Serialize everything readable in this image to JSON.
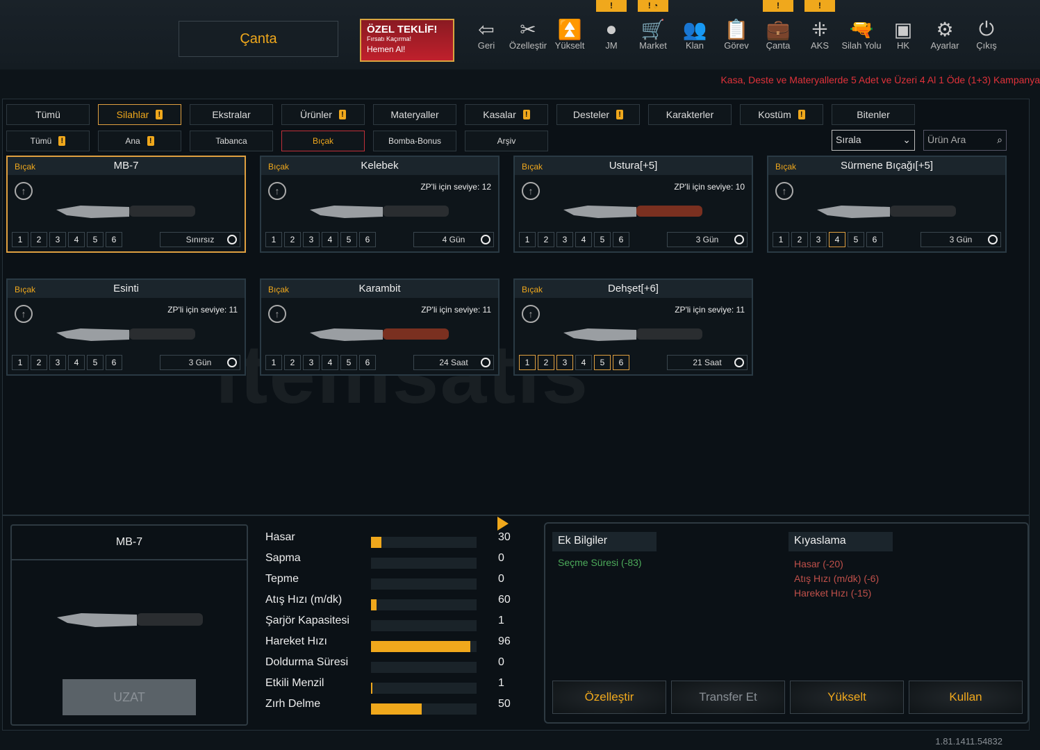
{
  "header": {
    "canta_button": "Çanta",
    "offer": {
      "title": "ÖZEL TEKLİF!",
      "subtitle": "Fırsatı Kaçırma!",
      "cta": "Hemen Al!"
    },
    "nav": [
      {
        "label": "Geri",
        "icon": "exit-icon",
        "glyph": "⇦"
      },
      {
        "label": "Özelleştir",
        "icon": "tools-icon",
        "glyph": "✂"
      },
      {
        "label": "Yükselt",
        "icon": "rank-up-icon",
        "glyph": "⏫"
      },
      {
        "label": "JM",
        "icon": "coins-icon",
        "glyph": "●"
      },
      {
        "label": "Market",
        "icon": "cart-icon",
        "glyph": "🛒"
      },
      {
        "label": "Klan",
        "icon": "clan-icon",
        "glyph": "👥"
      },
      {
        "label": "Görev",
        "icon": "clipboard-icon",
        "glyph": "📋"
      },
      {
        "label": "Çanta",
        "icon": "bag-icon",
        "glyph": "💼"
      },
      {
        "label": "AKS",
        "icon": "dots-icon",
        "glyph": "⁜"
      },
      {
        "label": "Silah Yolu",
        "icon": "pistol-icon",
        "glyph": "🔫"
      },
      {
        "label": "HK",
        "icon": "wallet-icon",
        "glyph": "▣"
      },
      {
        "label": "Ayarlar",
        "icon": "gear-icon",
        "glyph": "⚙"
      },
      {
        "label": "Çıkış",
        "icon": "power-icon",
        "glyph": "⏻"
      }
    ],
    "badges": [
      "!",
      "! ◔",
      "!",
      "!"
    ],
    "promo": "Kasa, Deste ve Materyallerde 5 Adet ve Üzeri 4 Al 1 Öde (1+3) Kampanya"
  },
  "tabs": [
    {
      "label": "Tümü"
    },
    {
      "label": "Silahlar",
      "alert": true
    },
    {
      "label": "Ekstralar"
    },
    {
      "label": "Ürünler",
      "alert": true
    },
    {
      "label": "Materyaller"
    },
    {
      "label": "Kasalar",
      "alert": true
    },
    {
      "label": "Desteler",
      "alert": true
    },
    {
      "label": "Karakterler"
    },
    {
      "label": "Kostüm",
      "alert": true
    },
    {
      "label": "Bitenler"
    }
  ],
  "subtabs": [
    {
      "label": "Tümü",
      "alert": true
    },
    {
      "label": "Ana",
      "alert": true
    },
    {
      "label": "Tabanca"
    },
    {
      "label": "Bıçak"
    },
    {
      "label": "Bomba-Bonus"
    },
    {
      "label": "Arşiv"
    }
  ],
  "sort": {
    "label": "Sırala"
  },
  "search": {
    "placeholder": "Ürün Ara"
  },
  "cards": [
    {
      "category": "Bıçak",
      "name": "MB-7",
      "level": "",
      "time": "Sınırsız",
      "slots_on": []
    },
    {
      "category": "Bıçak",
      "name": "Kelebek",
      "level": "ZP'li için seviye: 12",
      "time": "4 Gün",
      "slots_on": []
    },
    {
      "category": "Bıçak",
      "name": "Ustura[+5]",
      "level": "ZP'li için seviye: 10",
      "time": "3 Gün",
      "slots_on": []
    },
    {
      "category": "Bıçak",
      "name": "Sürmene Bıçağı[+5]",
      "level": "",
      "time": "3 Gün",
      "slots_on": [
        4
      ]
    },
    {
      "category": "Bıçak",
      "name": "Esinti",
      "level": "ZP'li için seviye: 11",
      "time": "3 Gün",
      "slots_on": []
    },
    {
      "category": "Bıçak",
      "name": "Karambit",
      "level": "ZP'li için seviye: 11",
      "time": "24 Saat",
      "slots_on": []
    },
    {
      "category": "Bıçak",
      "name": "Dehşet[+6]",
      "level": "ZP'li için seviye: 11",
      "time": "21 Saat",
      "slots_on": [
        1,
        2,
        3,
        5,
        6
      ]
    }
  ],
  "watermark": "itemsatis",
  "preview": {
    "name": "MB-7",
    "button": "UZAT"
  },
  "stats": [
    {
      "label": "Hasar",
      "value": "30",
      "fill": 0.1
    },
    {
      "label": "Sapma",
      "value": "0",
      "fill": 0
    },
    {
      "label": "Tepme",
      "value": "0",
      "fill": 0
    },
    {
      "label": "Atış Hızı (m/dk)",
      "value": "60",
      "fill": 0.05
    },
    {
      "label": "Şarjör Kapasitesi",
      "value": "1",
      "fill": 0
    },
    {
      "label": "Hareket Hızı",
      "value": "96",
      "fill": 0.94
    },
    {
      "label": "Doldurma Süresi",
      "value": "0",
      "fill": 0
    },
    {
      "label": "Etkili Menzil",
      "value": "1",
      "fill": 0.01
    },
    {
      "label": "Zırh Delme",
      "value": "50",
      "fill": 0.48
    }
  ],
  "extra": {
    "title": "Ek Bilgiler",
    "items": [
      "Seçme Süresi (-83)"
    ]
  },
  "compare": {
    "title": "Kıyaslama",
    "items": [
      "Hasar (-20)",
      "Atış Hızı (m/dk) (-6)",
      "Hareket Hızı (-15)"
    ]
  },
  "actions": [
    {
      "label": "Özelleştir"
    },
    {
      "label": "Transfer Et",
      "disabled": true
    },
    {
      "label": "Yükselt"
    },
    {
      "label": "Kullan"
    }
  ],
  "version": "1.81.1411.54832"
}
